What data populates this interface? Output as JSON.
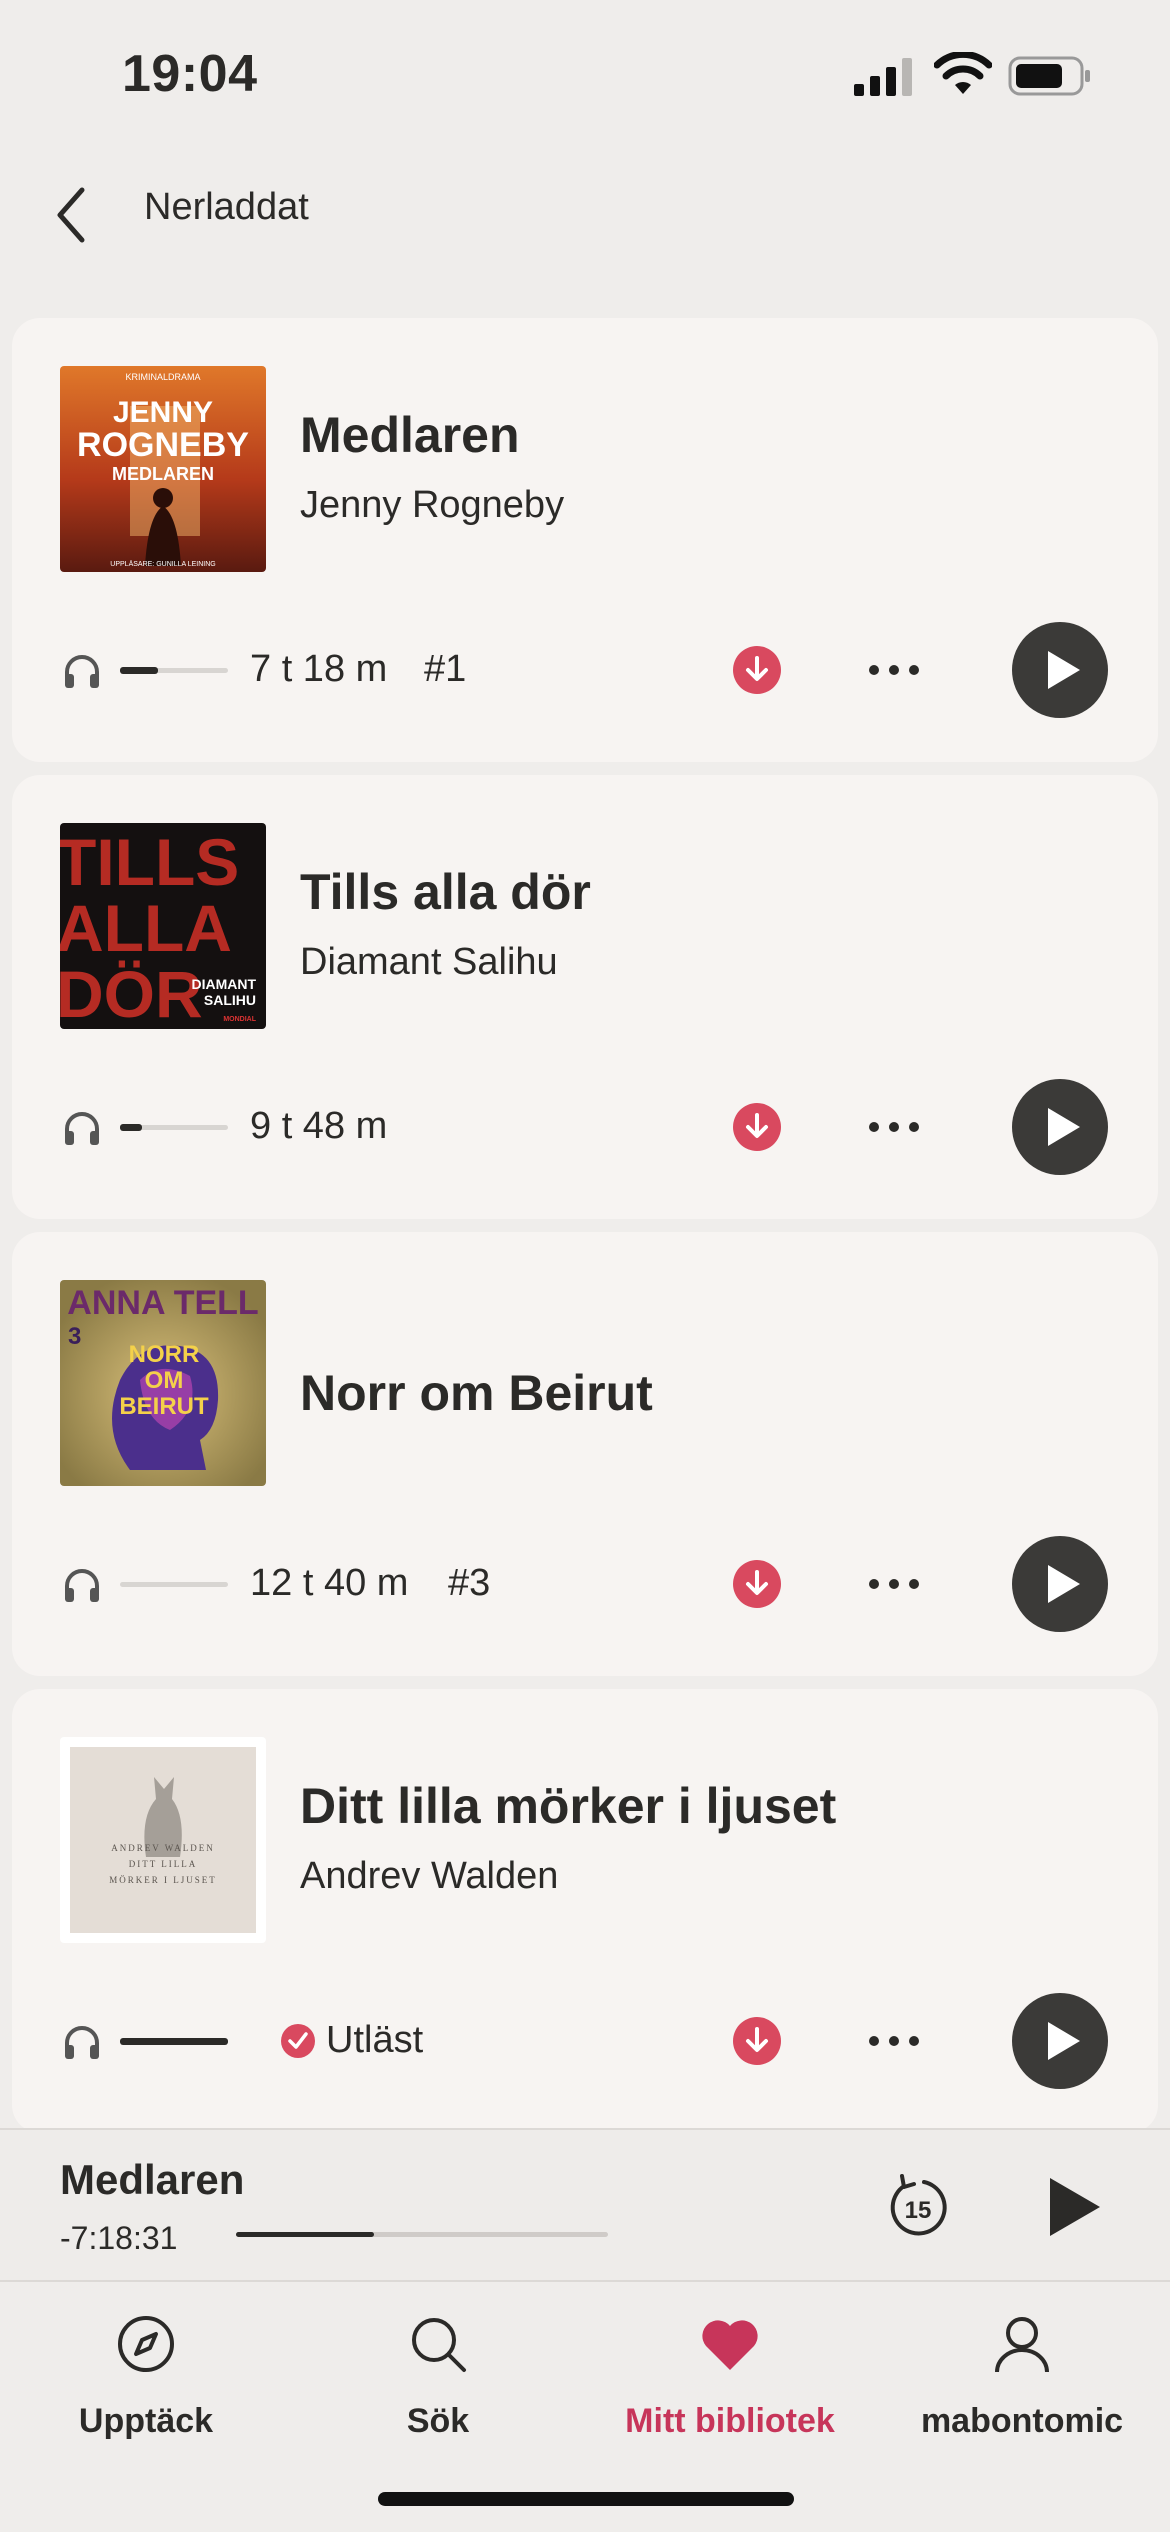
{
  "status": {
    "time": "19:04"
  },
  "header": {
    "title": "Nerladdat"
  },
  "colors": {
    "accent": "#c7355a",
    "download": "#d9495f",
    "play": "#3b3a38",
    "card": "#f7f4f2",
    "background": "#efedeb"
  },
  "books": [
    {
      "title": "Medlaren",
      "author": "Jenny Rogneby",
      "duration": "7 t 18 m",
      "series": "#1",
      "progress": 0.35,
      "finished": false,
      "cover": {
        "top_line": "KRIMINALDRAMA",
        "name1": "JENNY",
        "name2": "ROGNEBY",
        "book": "MEDLAREN",
        "bottom": "UPPLÄSARE: GUNILLA LEINING"
      }
    },
    {
      "title": "Tills alla dör",
      "author": "Diamant Salihu",
      "duration": "9 t 48 m",
      "series": "",
      "progress": 0.2,
      "finished": false,
      "cover": {
        "big1": "TILLS",
        "big2": "ALLA",
        "big3": "DÖR",
        "name1": "DIAMANT",
        "name2": "SALIHU",
        "pub": "MONDIAL"
      }
    },
    {
      "title": "Norr om Beirut",
      "author": "",
      "duration": "12 t 40 m",
      "series": "#3",
      "progress": 0.0,
      "finished": false,
      "cover": {
        "author": "ANNA TELL",
        "num": "3",
        "line1": "NORR",
        "line2": "OM",
        "line3": "BEIRUT"
      }
    },
    {
      "title": "Ditt lilla mörker i ljuset",
      "author": "Andrev Walden",
      "duration": "",
      "series": "",
      "progress": 1.0,
      "finished": true,
      "finished_label": "Utläst",
      "cover": {
        "author": "ANDREV WALDEN",
        "line1": "DITT LILLA",
        "line2": "MÖRKER I LJUSET"
      }
    }
  ],
  "mini_player": {
    "title": "Medlaren",
    "remaining": "-7:18:31",
    "progress": 0.37,
    "skip_seconds": "15"
  },
  "tabs": [
    {
      "label": "Upptäck",
      "icon": "compass-icon",
      "active": false
    },
    {
      "label": "Sök",
      "icon": "search-icon",
      "active": false
    },
    {
      "label": "Mitt bibliotek",
      "icon": "heart-icon",
      "active": true
    },
    {
      "label": "mabontomic",
      "icon": "profile-icon",
      "active": false
    }
  ]
}
